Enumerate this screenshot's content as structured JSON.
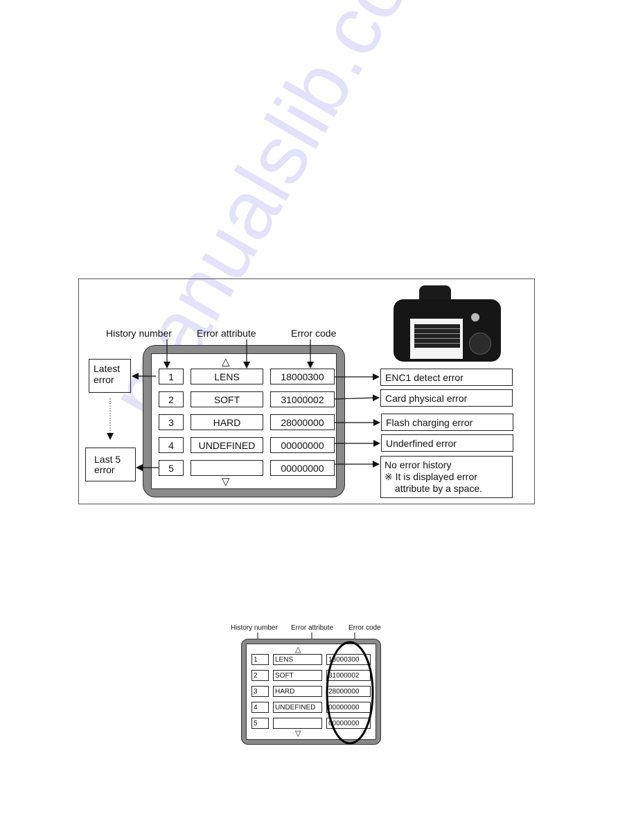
{
  "main_diagram": {
    "column_labels": {
      "history_number": "History number",
      "error_attribute": "Error attribute",
      "error_code": "Error code"
    },
    "side_labels": {
      "latest": "Latest\nerror",
      "last": "Last 5\nerror"
    },
    "scroll_up_symbol": "△",
    "scroll_down_symbol": "▽",
    "rows": [
      {
        "number": "1",
        "attribute": "LENS",
        "code": "18000300",
        "description": "ENC1 detect error"
      },
      {
        "number": "2",
        "attribute": "SOFT",
        "code": "31000002",
        "description": "Card physical error"
      },
      {
        "number": "3",
        "attribute": "HARD",
        "code": "28000000",
        "description": "Flash charging error"
      },
      {
        "number": "4",
        "attribute": "UNDEFINED",
        "code": "00000000",
        "description": "Underfined error"
      },
      {
        "number": "5",
        "attribute": "",
        "code": "00000000",
        "description": "No error history"
      }
    ],
    "note_mark": "※",
    "note_text_line1": "It is displayed error",
    "note_text_line2": "attribute by a space.",
    "camera_image": "camera-back-photo"
  },
  "small_diagram": {
    "column_labels": {
      "history_number": "History number",
      "error_attribute": "Error attribute",
      "error_code": "Error code"
    },
    "scroll_up_symbol": "△",
    "scroll_down_symbol": "▽",
    "rows": [
      {
        "number": "1",
        "attribute": "LENS",
        "code": "18000300"
      },
      {
        "number": "2",
        "attribute": "SOFT",
        "code": "31000002"
      },
      {
        "number": "3",
        "attribute": "HARD",
        "code": "28000000"
      },
      {
        "number": "4",
        "attribute": "UNDEFINED",
        "code": "00000000"
      },
      {
        "number": "5",
        "attribute": "",
        "code": "00000000"
      }
    ]
  },
  "watermark": "manualslib.com",
  "colors": {
    "frame_gray": "#8a8a8a",
    "watermark": "#c9c8f5"
  }
}
